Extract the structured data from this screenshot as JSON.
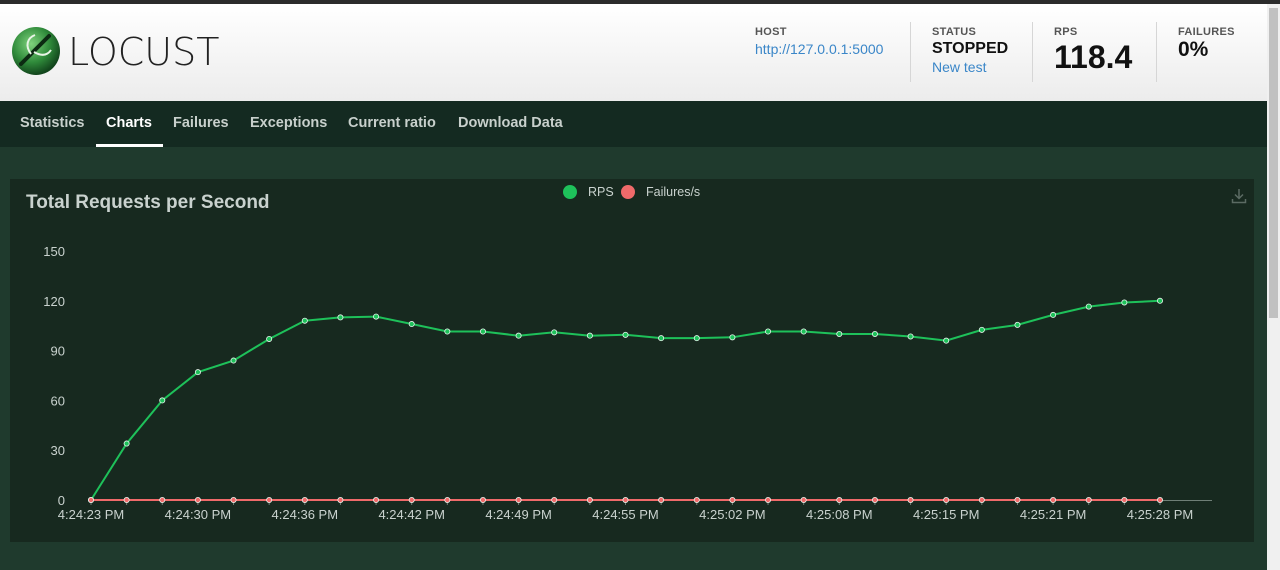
{
  "header": {
    "logo_text": "LOCUST",
    "host_label": "HOST",
    "host_value": "http://127.0.0.1:5000",
    "status_label": "STATUS",
    "status_value": "STOPPED",
    "new_test_label": "New test",
    "rps_label": "RPS",
    "rps_value": "118.4",
    "failures_label": "FAILURES",
    "failures_value": "0%"
  },
  "nav": {
    "tabs": [
      {
        "label": "Statistics"
      },
      {
        "label": "Charts"
      },
      {
        "label": "Failures"
      },
      {
        "label": "Exceptions"
      },
      {
        "label": "Current ratio"
      },
      {
        "label": "Download Data"
      }
    ],
    "active_tab": "Charts"
  },
  "icons": {
    "logo": "locust-logo-icon",
    "download": "download-icon"
  },
  "colors": {
    "rps": "#1ec15a",
    "failures": "#f06a6a",
    "accent_link": "#3a86c8"
  },
  "chart_data": {
    "type": "line",
    "title": "Total Requests per Second",
    "legend_position": "top-center",
    "grid": false,
    "ylim": [
      0,
      150
    ],
    "y_ticks": [
      0,
      30,
      60,
      90,
      120,
      150
    ],
    "x_tick_labels": [
      "4:24:23 PM",
      "4:24:30 PM",
      "4:24:36 PM",
      "4:24:42 PM",
      "4:24:49 PM",
      "4:24:55 PM",
      "4:25:02 PM",
      "4:25:08 PM",
      "4:25:15 PM",
      "4:25:21 PM",
      "4:25:28 PM"
    ],
    "series": [
      {
        "name": "RPS",
        "color": "#1ec15a",
        "values": [
          0,
          34,
          60,
          77,
          84,
          97,
          108,
          110,
          110.5,
          106,
          101.5,
          101.5,
          99,
          101,
          99,
          99.5,
          97.5,
          97.5,
          98,
          101.5,
          101.5,
          100,
          100,
          98.5,
          96,
          102.5,
          105.5,
          111.5,
          116.5,
          119,
          120
        ]
      },
      {
        "name": "Failures/s",
        "color": "#f06a6a",
        "values": [
          0,
          0,
          0,
          0,
          0,
          0,
          0,
          0,
          0,
          0,
          0,
          0,
          0,
          0,
          0,
          0,
          0,
          0,
          0,
          0,
          0,
          0,
          0,
          0,
          0,
          0,
          0,
          0,
          0,
          0,
          0
        ]
      }
    ]
  }
}
